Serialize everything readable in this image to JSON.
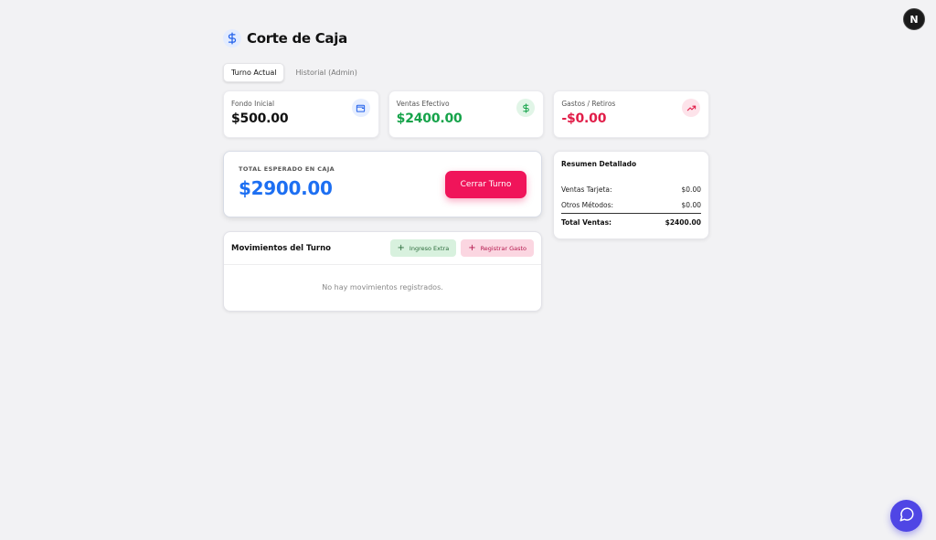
{
  "header": {
    "title": "Corte de Caja",
    "icon": "dollar-icon"
  },
  "tabs": [
    {
      "label": "Turno Actual",
      "active": true
    },
    {
      "label": "Historial (Admin)",
      "active": false
    }
  ],
  "stats": {
    "fondo": {
      "label": "Fondo Inicial",
      "value": "$500.00",
      "color": "#111111",
      "icon": "wallet-icon"
    },
    "ventas": {
      "label": "Ventas Efectivo",
      "value": "$2400.00",
      "color": "#16a34a",
      "icon": "dollar-icon"
    },
    "gastos": {
      "label": "Gastos / Retiros",
      "value": "-$0.00",
      "color": "#e11d48",
      "icon": "trending-up-icon"
    }
  },
  "total": {
    "label": "TOTAL ESPERADO EN CAJA",
    "value": "$2900.00",
    "close_label": "Cerrar Turno",
    "accent": "#1d6ff2",
    "button_color": "#f0145a"
  },
  "movements": {
    "title": "Movimientos del Turno",
    "add_income_label": "Ingreso Extra",
    "add_expense_label": "Registrar Gasto",
    "empty_text": "No hay movimientos registrados."
  },
  "summary": {
    "title": "Resumen Detallado",
    "rows": [
      {
        "label": "Ventas Tarjeta:",
        "value": "$0.00"
      },
      {
        "label": "Otros Métodos:",
        "value": "$0.00"
      }
    ],
    "total_label": "Total Ventas:",
    "total_value": "$2400.00"
  },
  "user": {
    "avatar_initial": "N"
  },
  "chat": {
    "icon": "chat-bubble-icon",
    "color": "#4f46e5"
  }
}
